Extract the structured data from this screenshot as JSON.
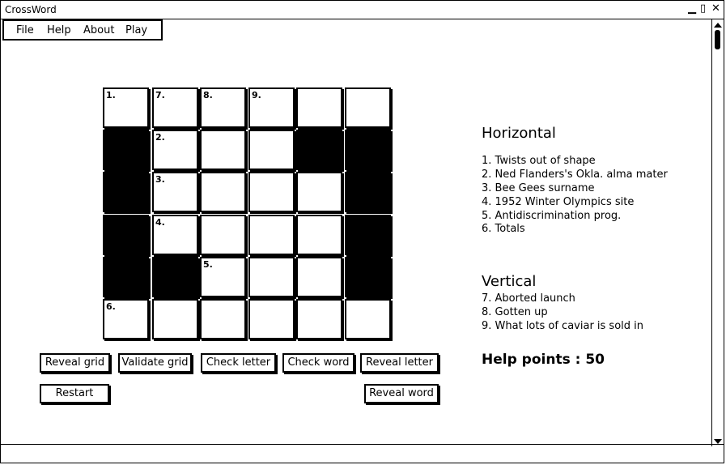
{
  "window": {
    "title": "CrossWord",
    "controls": [
      "minimize-icon",
      "maximize-icon",
      "close-icon"
    ]
  },
  "menu": {
    "items": [
      "File",
      "Help",
      "About",
      "Play"
    ]
  },
  "grid": {
    "rows": 6,
    "cols": 6,
    "black_cells": [
      [
        1,
        0
      ],
      [
        1,
        4
      ],
      [
        1,
        5
      ],
      [
        2,
        0
      ],
      [
        2,
        5
      ],
      [
        3,
        0
      ],
      [
        3,
        5
      ],
      [
        4,
        0
      ],
      [
        4,
        1
      ],
      [
        4,
        5
      ]
    ],
    "numbers": [
      {
        "r": 0,
        "c": 0,
        "n": "1."
      },
      {
        "r": 0,
        "c": 1,
        "n": "7."
      },
      {
        "r": 0,
        "c": 2,
        "n": "8."
      },
      {
        "r": 0,
        "c": 3,
        "n": "9."
      },
      {
        "r": 1,
        "c": 1,
        "n": "2."
      },
      {
        "r": 2,
        "c": 1,
        "n": "3."
      },
      {
        "r": 3,
        "c": 1,
        "n": "4."
      },
      {
        "r": 4,
        "c": 2,
        "n": "5."
      },
      {
        "r": 5,
        "c": 0,
        "n": "6."
      }
    ]
  },
  "clues": {
    "horizontal_title": "Horizontal",
    "horizontal": [
      "1. Twists out of shape",
      "2. Ned Flanders's Okla. alma mater",
      "3. Bee Gees surname",
      "4. 1952 Winter Olympics site",
      "5. Antidiscrimination prog.",
      "6. Totals"
    ],
    "vertical_title": "Vertical",
    "vertical": [
      "7. Aborted launch",
      "8. Gotten up",
      "9. What lots of caviar is sold in"
    ]
  },
  "help_points": "Help points : 50",
  "buttons": {
    "reveal_grid": "Reveal grid",
    "validate_grid": "Validate grid",
    "check_letter": "Check letter",
    "check_word": "Check word",
    "reveal_letter": "Reveal letter",
    "restart": "Restart",
    "reveal_word": "Reveal word"
  }
}
